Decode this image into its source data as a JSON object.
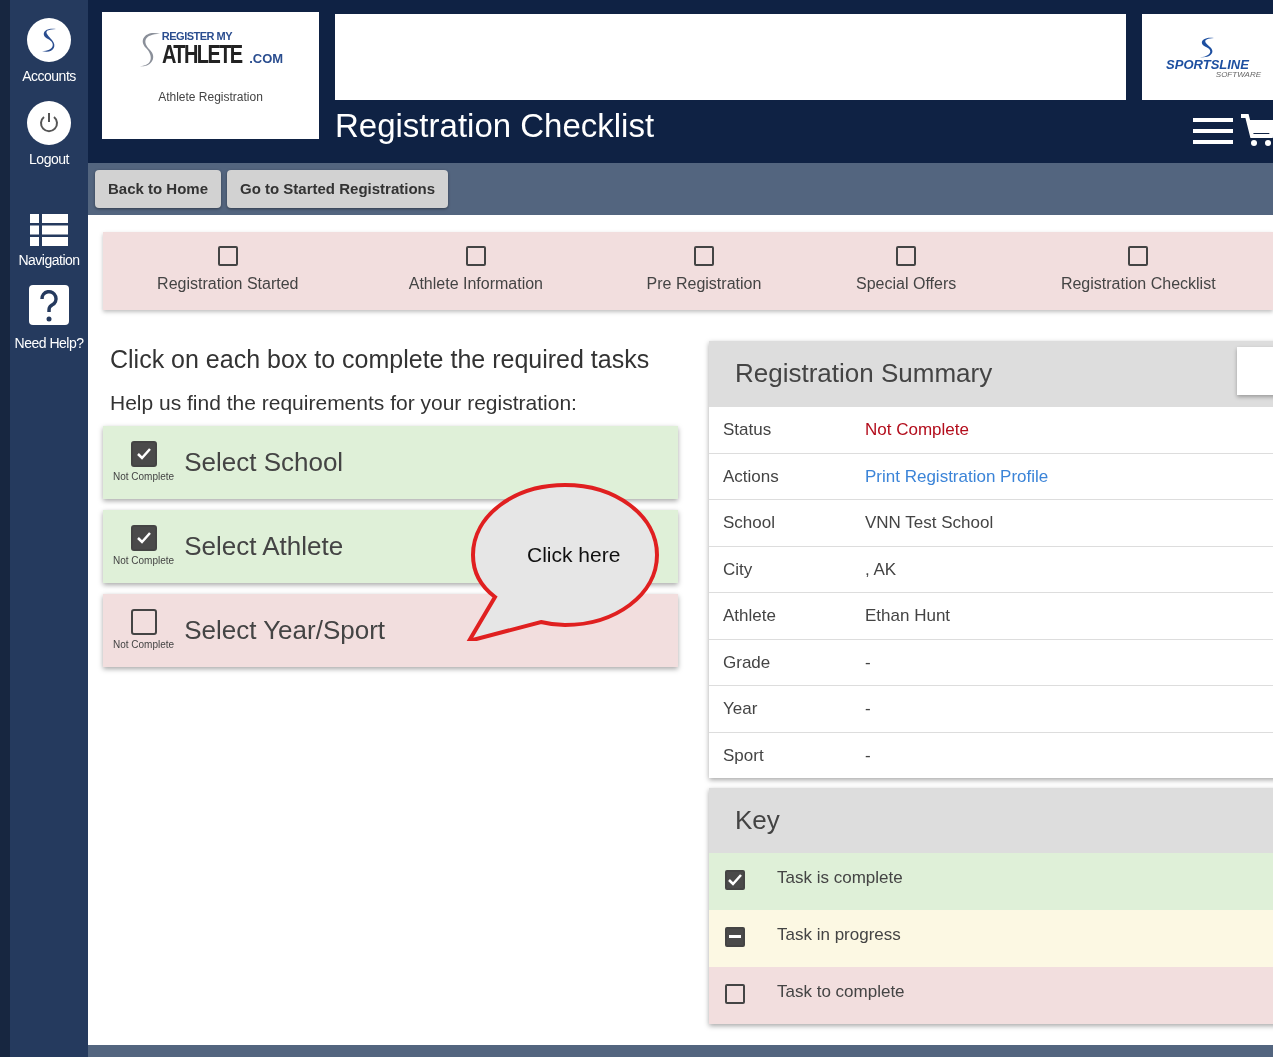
{
  "rail": [
    {
      "kind": "logo",
      "label": "Accounts"
    },
    {
      "kind": "power",
      "label": "Logout"
    },
    {
      "kind": "list",
      "label": "Navigation"
    },
    {
      "kind": "help",
      "label": "Need Help?"
    }
  ],
  "logo": {
    "line1": "REGISTER MY",
    "line2": "ATHLETE",
    "suffix": ".COM",
    "caption": "Athlete Registration"
  },
  "partner_logo": {
    "line1": "SPORTSLINE",
    "line2": "SOFTWARE"
  },
  "page_title": "Registration Checklist",
  "toolbar": [
    "Back to Home",
    "Go to Started Registrations"
  ],
  "steps": [
    {
      "label": "Registration Started",
      "checked": false
    },
    {
      "label": "Athlete Information",
      "checked": false
    },
    {
      "label": "Pre Registration",
      "checked": false
    },
    {
      "label": "Special Offers",
      "checked": false
    },
    {
      "label": "Registration Checklist",
      "checked": false
    }
  ],
  "instructions": {
    "heading": "Click on each box to complete the required tasks",
    "subheading": "Help us find the requirements for your registration:"
  },
  "tasks": [
    {
      "label": "Select School",
      "status": "Not Complete",
      "checked": true
    },
    {
      "label": "Select Athlete",
      "status": "Not Complete",
      "checked": true
    },
    {
      "label": "Select Year/Sport",
      "status": "Not Complete",
      "checked": false
    }
  ],
  "callout": "Click here",
  "summary": {
    "title": "Registration Summary",
    "rows": [
      {
        "label": "Status",
        "value": "Not Complete",
        "kind": "alert"
      },
      {
        "label": "Actions",
        "value": "Print Registration Profile",
        "kind": "link"
      },
      {
        "label": "School",
        "value": "VNN Test School",
        "kind": "text"
      },
      {
        "label": "City",
        "value": ", AK",
        "kind": "text"
      },
      {
        "label": "Athlete",
        "value": "Ethan Hunt",
        "kind": "text"
      },
      {
        "label": "Grade",
        "value": "-",
        "kind": "text"
      },
      {
        "label": "Year",
        "value": "-",
        "kind": "text"
      },
      {
        "label": "Sport",
        "value": "-",
        "kind": "text"
      }
    ]
  },
  "key": {
    "title": "Key",
    "items": [
      {
        "label": "Task is complete",
        "kind": "complete"
      },
      {
        "label": "Task in progress",
        "kind": "progress"
      },
      {
        "label": "Task to complete",
        "kind": "todo"
      }
    ]
  }
}
